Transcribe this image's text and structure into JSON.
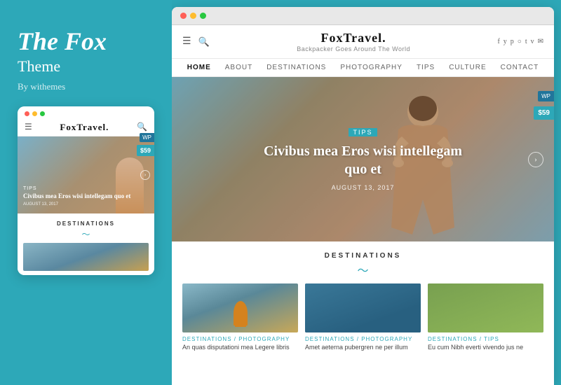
{
  "left": {
    "title": "The Fox",
    "subtitle": "Theme",
    "by": "By withemes",
    "mobile_preview": {
      "logo": "FoxTravel.",
      "tips_badge": "TIPS",
      "hero_title": "Civibus mea Eros wisi intellegam quo et",
      "hero_date": "AUGUST 13, 2017",
      "price_badge": "$59",
      "destinations_label": "DESTINATIONS"
    }
  },
  "right": {
    "browser_dots": [
      "red",
      "yellow",
      "green"
    ],
    "header": {
      "logo": "FoxTravel.",
      "tagline": "Backpacker Goes Around The World",
      "social_icons": [
        "f",
        "y",
        "p",
        "y",
        "t",
        "v",
        "✉"
      ]
    },
    "nav": {
      "items": [
        "HOME",
        "ABOUT",
        "DESTINATIONS",
        "PHOTOGRAPHY",
        "TIPS",
        "CULTURE",
        "CONTACT"
      ],
      "active": "HOME"
    },
    "hero": {
      "badge": "TIPS",
      "title": "Civibus mea Eros wisi intellegam quo et",
      "date": "AUGUST 13, 2017",
      "wp_badge": "WP",
      "price_badge": "$59"
    },
    "destinations": {
      "label": "DESTINATIONS",
      "cards": [
        {
          "tag": "DESTINATIONS / PHOTOGRAPHY",
          "text": "An quas disputationi mea Legere libris"
        },
        {
          "tag": "DESTINATIONS / PHOTOGRAPHY",
          "text": "Amet aeterna pubergren ne per illum"
        },
        {
          "tag": "DESTINATIONS / TIPS",
          "text": "Eu cum Nibh everti vivendo jus ne"
        }
      ]
    }
  }
}
